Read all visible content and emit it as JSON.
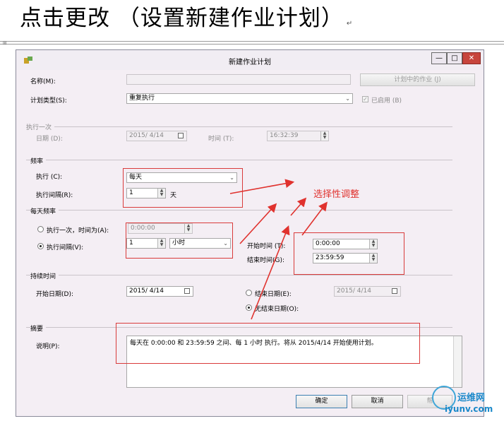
{
  "heading": "点击更改 （设置新建作业计划）",
  "dialog": {
    "title": "新建作业计划",
    "controls": {
      "minimize": "—",
      "maximize": "□",
      "close": "✕"
    },
    "name": {
      "label": "名称(M):",
      "value": "",
      "schedules_btn": "计划中的作业 (J)"
    },
    "schedule_type": {
      "label": "计划类型(S):",
      "value": "重复执行",
      "enabled_label": "已启用 (B)",
      "enabled": true
    },
    "one_time": {
      "section": "执行一次",
      "date_label": "日期 (D):",
      "date_value": "2015/ 4/14",
      "time_label": "时间 (T):",
      "time_value": "16:32:39"
    },
    "frequency": {
      "section": "频率",
      "occurs_label": "执行 (C):",
      "occurs_value": "每天",
      "interval_label": "执行间隔(R):",
      "interval_value": "1",
      "interval_unit": "天"
    },
    "daily_frequency": {
      "section": "每天频率",
      "once_label": "执行一次，时间为(A):",
      "once_value": "0:00:00",
      "every_label": "执行间隔(V):",
      "every_value": "1",
      "every_unit": "小时",
      "start_label": "开始时间 (T):",
      "start_value": "0:00:00",
      "end_label": "结束时间(G):",
      "end_value": "23:59:59"
    },
    "duration": {
      "section": "持续时间",
      "start_label": "开始日期(D):",
      "start_value": "2015/ 4/14",
      "end_date_label": "结束日期(E):",
      "end_date_value": "2015/ 4/14",
      "no_end_label": "无结束日期(O):"
    },
    "summary": {
      "section": "摘要",
      "desc_label": "说明(P):",
      "desc_value": "每天在 0:00:00 和 23:59:59 之间、每 1 小时 执行。将从 2015/4/14 开始使用计划。"
    },
    "buttons": {
      "ok": "确定",
      "cancel": "取消",
      "help": "帮"
    }
  },
  "annotation": {
    "text": "选择性调整",
    "color": "#e0322e"
  },
  "watermark": {
    "cn": "运维网",
    "en": "iyunv.com"
  }
}
